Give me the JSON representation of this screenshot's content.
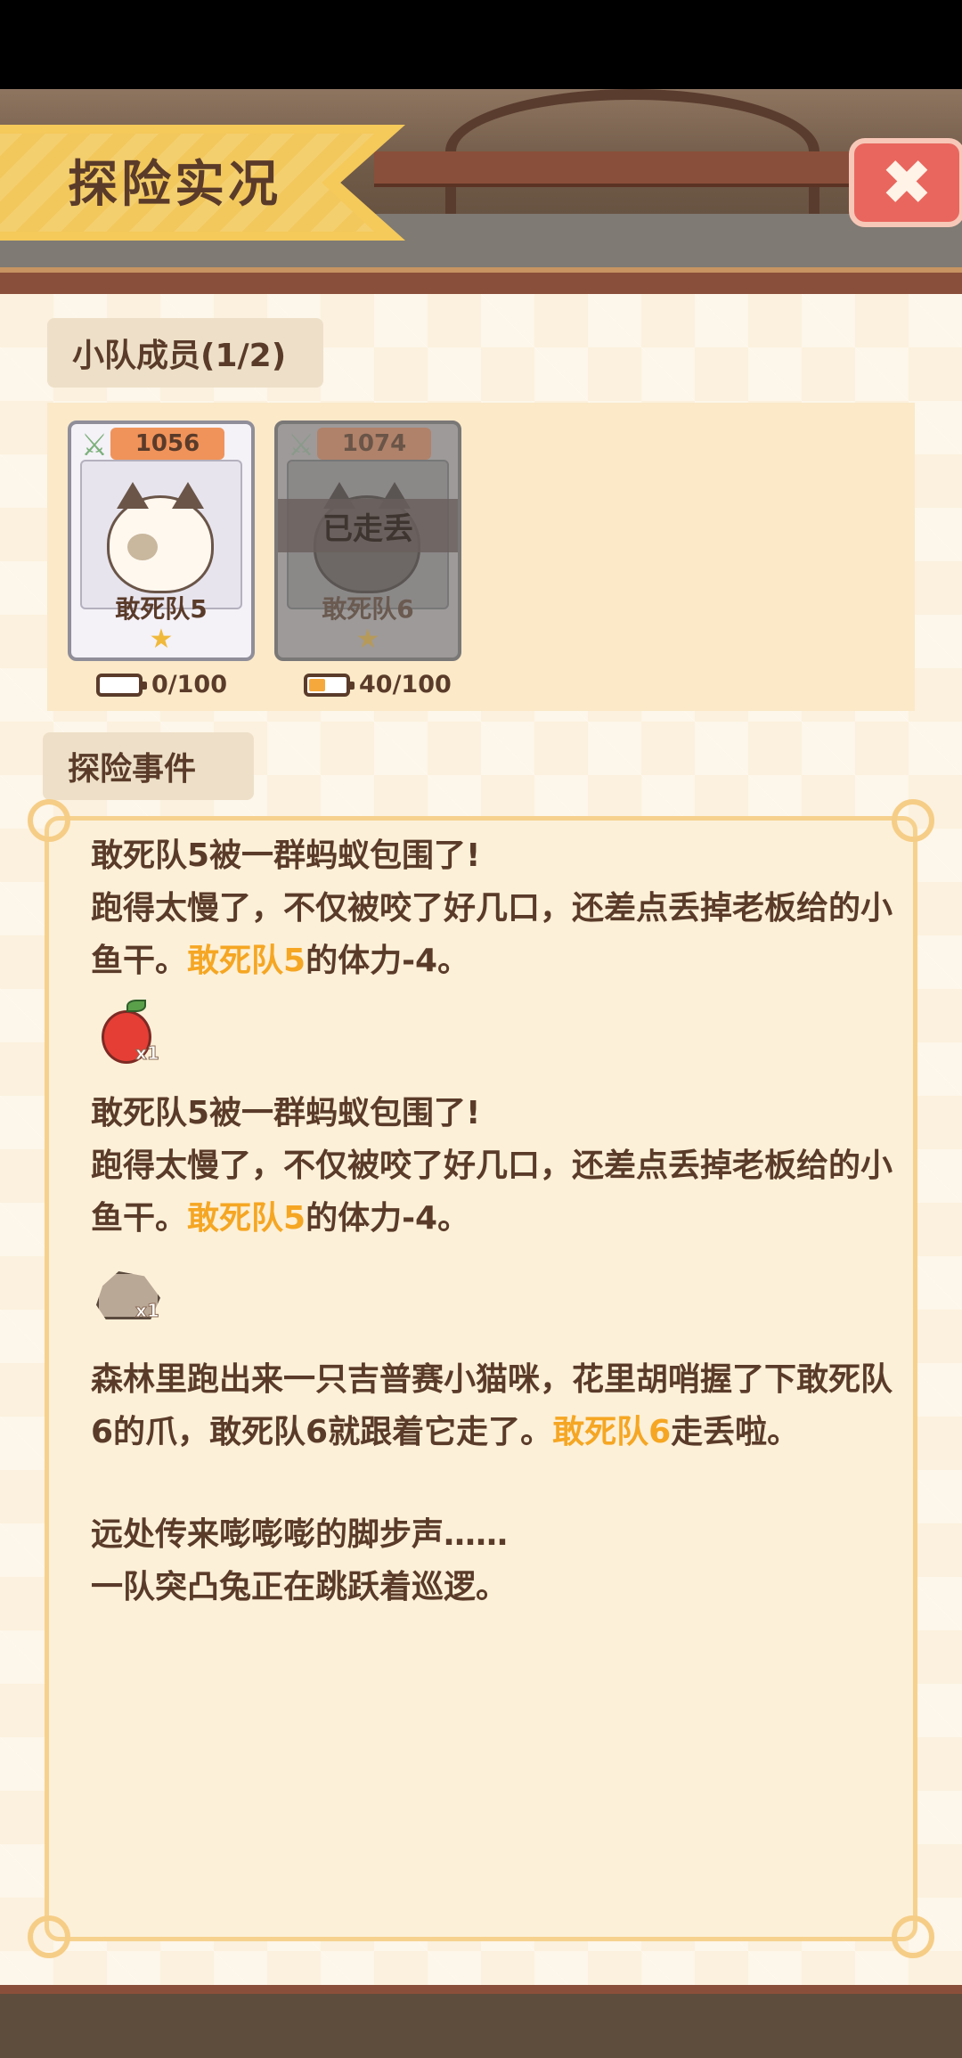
{
  "title": "探险实况",
  "close_symbol": "✖",
  "members": {
    "label": "小队成员(1/2)",
    "cards": [
      {
        "power": "1056",
        "name": "敢死队5",
        "status": "",
        "energy": "0/100",
        "energy_level": 0.0
      },
      {
        "power": "1074",
        "name": "敢死队6",
        "status": "已走丢",
        "energy": "40/100",
        "energy_level": 0.4
      }
    ]
  },
  "events": {
    "label": "探险事件",
    "e1_line1": "敢死队5被一群蚂蚁包围了!",
    "e1_line2": "跑得太慢了，不仅被咬了好几口，还差点丢掉老板给的小鱼干。",
    "e1_hl": "敢死队5",
    "e1_tail": "的体力-4。",
    "item1_qty": "x1",
    "e2_line1": "敢死队5被一群蚂蚁包围了!",
    "e2_line2": "跑得太慢了，不仅被咬了好几口，还差点丢掉老板给的小鱼干。",
    "e2_hl": "敢死队5",
    "e2_tail": "的体力-4。",
    "item2_qty": "x1",
    "e3_text": "森林里跑出来一只吉普赛小猫咪，花里胡哨握了下敢死队6的爪，敢死队6就跟着它走了。",
    "e3_hl": "敢死队6",
    "e3_tail": "走丢啦。",
    "e4_line1": "远处传来嘭嘭嘭的脚步声……",
    "e4_line2": "一队突凸兔正在跳跃着巡逻。"
  },
  "colors": {
    "highlight": "#f5a623",
    "text": "#5a3b2a",
    "banner": "#f5c95a",
    "close": "#e9665e"
  }
}
